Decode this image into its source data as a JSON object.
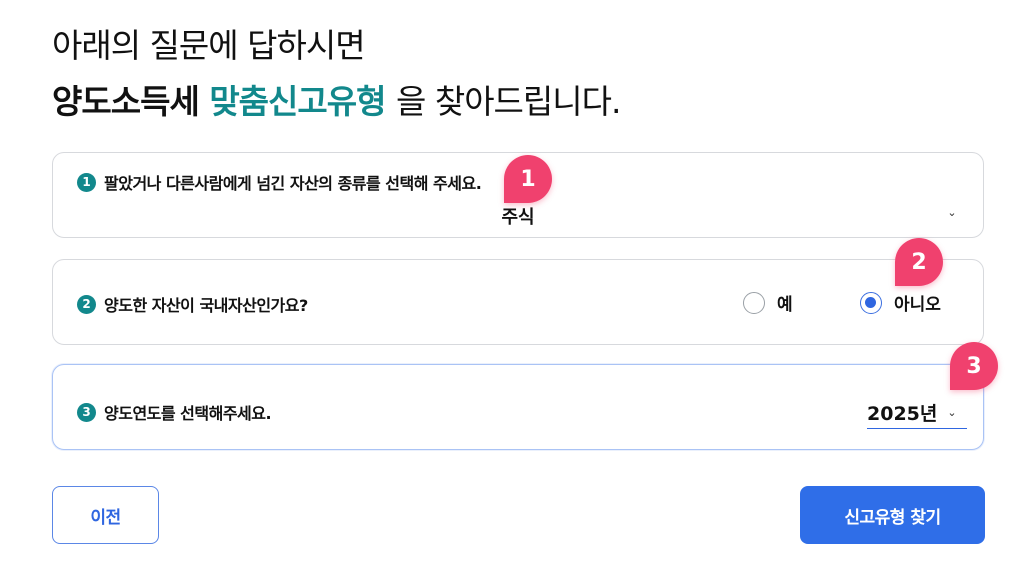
{
  "headline": {
    "line1": "아래의 질문에 답하시면",
    "line2_bold": "양도소득세",
    "line2_accent": "맞춤신고유형",
    "line2_rest": "을 찾아드립니다."
  },
  "questions": [
    {
      "number": "1",
      "label": "팔았거나 다른사람에게 넘긴 자산의 종류를 선택해 주세요.",
      "selected_value": "주식"
    },
    {
      "number": "2",
      "label": "양도한 자산이 국내자산인가요?",
      "options": [
        "예",
        "아니오"
      ],
      "selected_option": "아니오"
    },
    {
      "number": "3",
      "label": "양도연도를 선택해주세요.",
      "selected_value": "2025년"
    }
  ],
  "callouts": [
    "1",
    "2",
    "3"
  ],
  "buttons": {
    "prev": "이전",
    "find": "신고유형 찾기"
  },
  "colors": {
    "accent": "#12888c",
    "primary": "#2f6ee8",
    "callout": "#f0416e"
  }
}
